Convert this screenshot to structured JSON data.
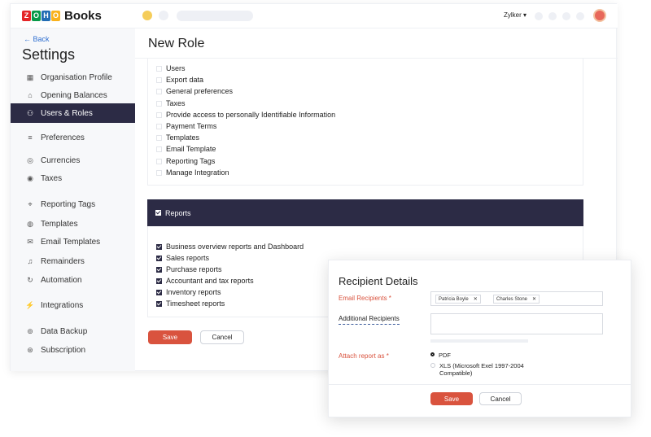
{
  "brand": {
    "logo_letters": [
      "Z",
      "O",
      "H",
      "O"
    ],
    "logo_colors": [
      "#e42527",
      "#089949",
      "#226db4",
      "#f9b21d"
    ],
    "product": "Books"
  },
  "topbar": {
    "org_name": "Zylker ▾"
  },
  "sidebar": {
    "back_label": "← Back",
    "title": "Settings",
    "items": [
      {
        "label": "Organisation Profile",
        "icon": "building-icon",
        "glyph": "▦"
      },
      {
        "label": "Opening Balances",
        "icon": "bank-icon",
        "glyph": "⌂"
      },
      {
        "label": "Users & Roles",
        "icon": "users-icon",
        "glyph": "⚇",
        "active": true
      },
      {
        "label": "Preferences",
        "icon": "sliders-icon",
        "glyph": "≡"
      },
      {
        "label": "Currencies",
        "icon": "currency-icon",
        "glyph": "◎"
      },
      {
        "label": "Taxes",
        "icon": "tax-icon",
        "glyph": "◉"
      },
      {
        "label": "Reporting Tags",
        "icon": "tag-icon",
        "glyph": "⌖"
      },
      {
        "label": "Templates",
        "icon": "template-icon",
        "glyph": "◍"
      },
      {
        "label": "Email Templates",
        "icon": "envelope-icon",
        "glyph": "✉"
      },
      {
        "label": "Remainders",
        "icon": "bell-icon",
        "glyph": "♫"
      },
      {
        "label": "Automation",
        "icon": "automation-icon",
        "glyph": "↻"
      },
      {
        "label": "Integrations",
        "icon": "plug-icon",
        "glyph": "⚡"
      },
      {
        "label": "Data Backup",
        "icon": "backup-icon",
        "glyph": "⊚"
      },
      {
        "label": "Subscription",
        "icon": "subscription-icon",
        "glyph": "⊛"
      }
    ]
  },
  "main": {
    "title": "New Role",
    "permissions": [
      "Users",
      "Export data",
      "General preferences",
      "Taxes",
      "Provide access to personally Identifiable Information",
      "Payment Terms",
      "Templates",
      "Email Template",
      "Reporting Tags",
      "Manage Integration"
    ],
    "reports_section_label": "Reports",
    "reports": [
      "Business overview reports and Dashboard",
      "Sales reports",
      "Purchase reports",
      "Accountant and tax reports",
      "Inventory reports",
      "Timesheet reports"
    ],
    "save_label": "Save",
    "cancel_label": "Cancel"
  },
  "modal": {
    "title": "Recipient Details",
    "email_recipients_label": "Email Recipients *",
    "recipients": [
      "Patricia Boyle",
      "Charles Stone"
    ],
    "additional_recipients_label": "Additional Recipients",
    "additional_recipients_value": "",
    "attach_label": "Attach report as *",
    "formats": [
      {
        "label": "PDF",
        "selected": true
      },
      {
        "label": "XLS (Microsoft Exel 1997-2004 Compatible)",
        "selected": false
      }
    ],
    "save_label": "Save",
    "cancel_label": "Cancel"
  },
  "colors": {
    "accent_dark": "#2c2b45",
    "primary_button": "#d9533e",
    "link": "#2f6fd0",
    "required_label": "#d9533e"
  }
}
